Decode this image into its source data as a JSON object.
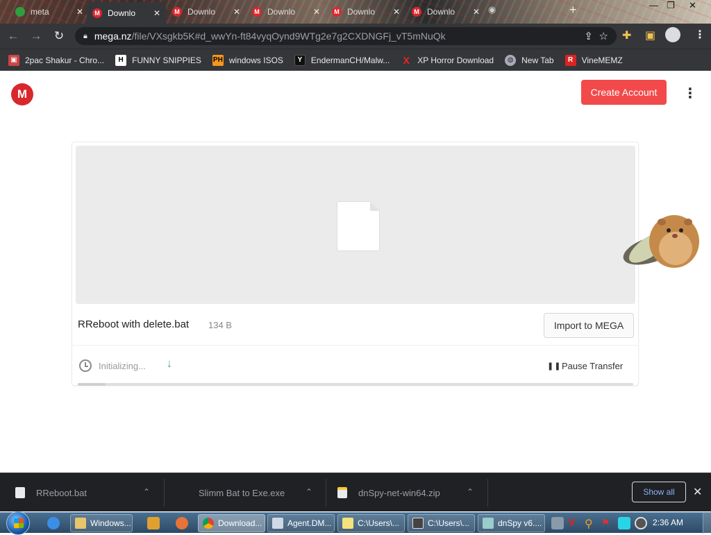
{
  "browser": {
    "tabs": [
      {
        "title": "meta",
        "favicon": "green",
        "active": false
      },
      {
        "title": "Downlo",
        "favicon": "mega",
        "active": true
      },
      {
        "title": "Downlo",
        "favicon": "mega",
        "active": false
      },
      {
        "title": "Downlo",
        "favicon": "mega",
        "active": false
      },
      {
        "title": "Downlo",
        "favicon": "mega",
        "active": false
      },
      {
        "title": "Downlo",
        "favicon": "mega",
        "active": false
      }
    ],
    "tab_close_glyph": "✕",
    "url_host": "mega.nz",
    "url_path": "/file/VXsgkb5K#d_wwYn-ft84vyqOynd9WTg2e7g2CXDNGFj_vT5mNuQk",
    "bookmarks": [
      {
        "label": "2pac Shakur - Chro...",
        "icon": "app-icon",
        "color": "#c44"
      },
      {
        "label": "FUNNY SNIPPIES",
        "icon": "h-icon",
        "color": "#fff"
      },
      {
        "label": "windows ISOS",
        "icon": "ph-icon",
        "color": "#f7971d"
      },
      {
        "label": "EndermanCH/Malw...",
        "icon": "yt-icon",
        "color": "#111"
      },
      {
        "label": "XP Horror Download",
        "icon": "x-icon",
        "color": "#d22"
      },
      {
        "label": "New Tab",
        "icon": "globe-icon",
        "color": "#88a"
      },
      {
        "label": "VineMEMZ",
        "icon": "r-icon",
        "color": "#d22"
      }
    ]
  },
  "mega": {
    "logo_letter": "M",
    "create_account": "Create Account",
    "file_name": "RReboot with delete.bat",
    "file_size": "134 B",
    "import_label": "Import to MEGA",
    "status": "Initializing...",
    "pause_label": "Pause Transfer",
    "progress_fraction": 0.05
  },
  "downloads": {
    "items": [
      {
        "name": "RReboot.bat"
      },
      {
        "name": "Slimm Bat to Exe.exe"
      },
      {
        "name": "dnSpy-net-win64.zip"
      }
    ],
    "show_all": "Show all"
  },
  "taskbar": {
    "items": [
      {
        "label": "Windows...",
        "color": "#e8c46a"
      },
      {
        "label": "Download...",
        "color": "#4a8cdc"
      },
      {
        "label": "Agent.DM...",
        "color": "#cfd8e6"
      },
      {
        "label": "C:\\Users\\...",
        "color": "#f4e27a"
      },
      {
        "label": "C:\\Users\\...",
        "color": "#444"
      },
      {
        "label": "dnSpy v6....",
        "color": "#9cc"
      }
    ],
    "clock": "2:36 AM"
  }
}
